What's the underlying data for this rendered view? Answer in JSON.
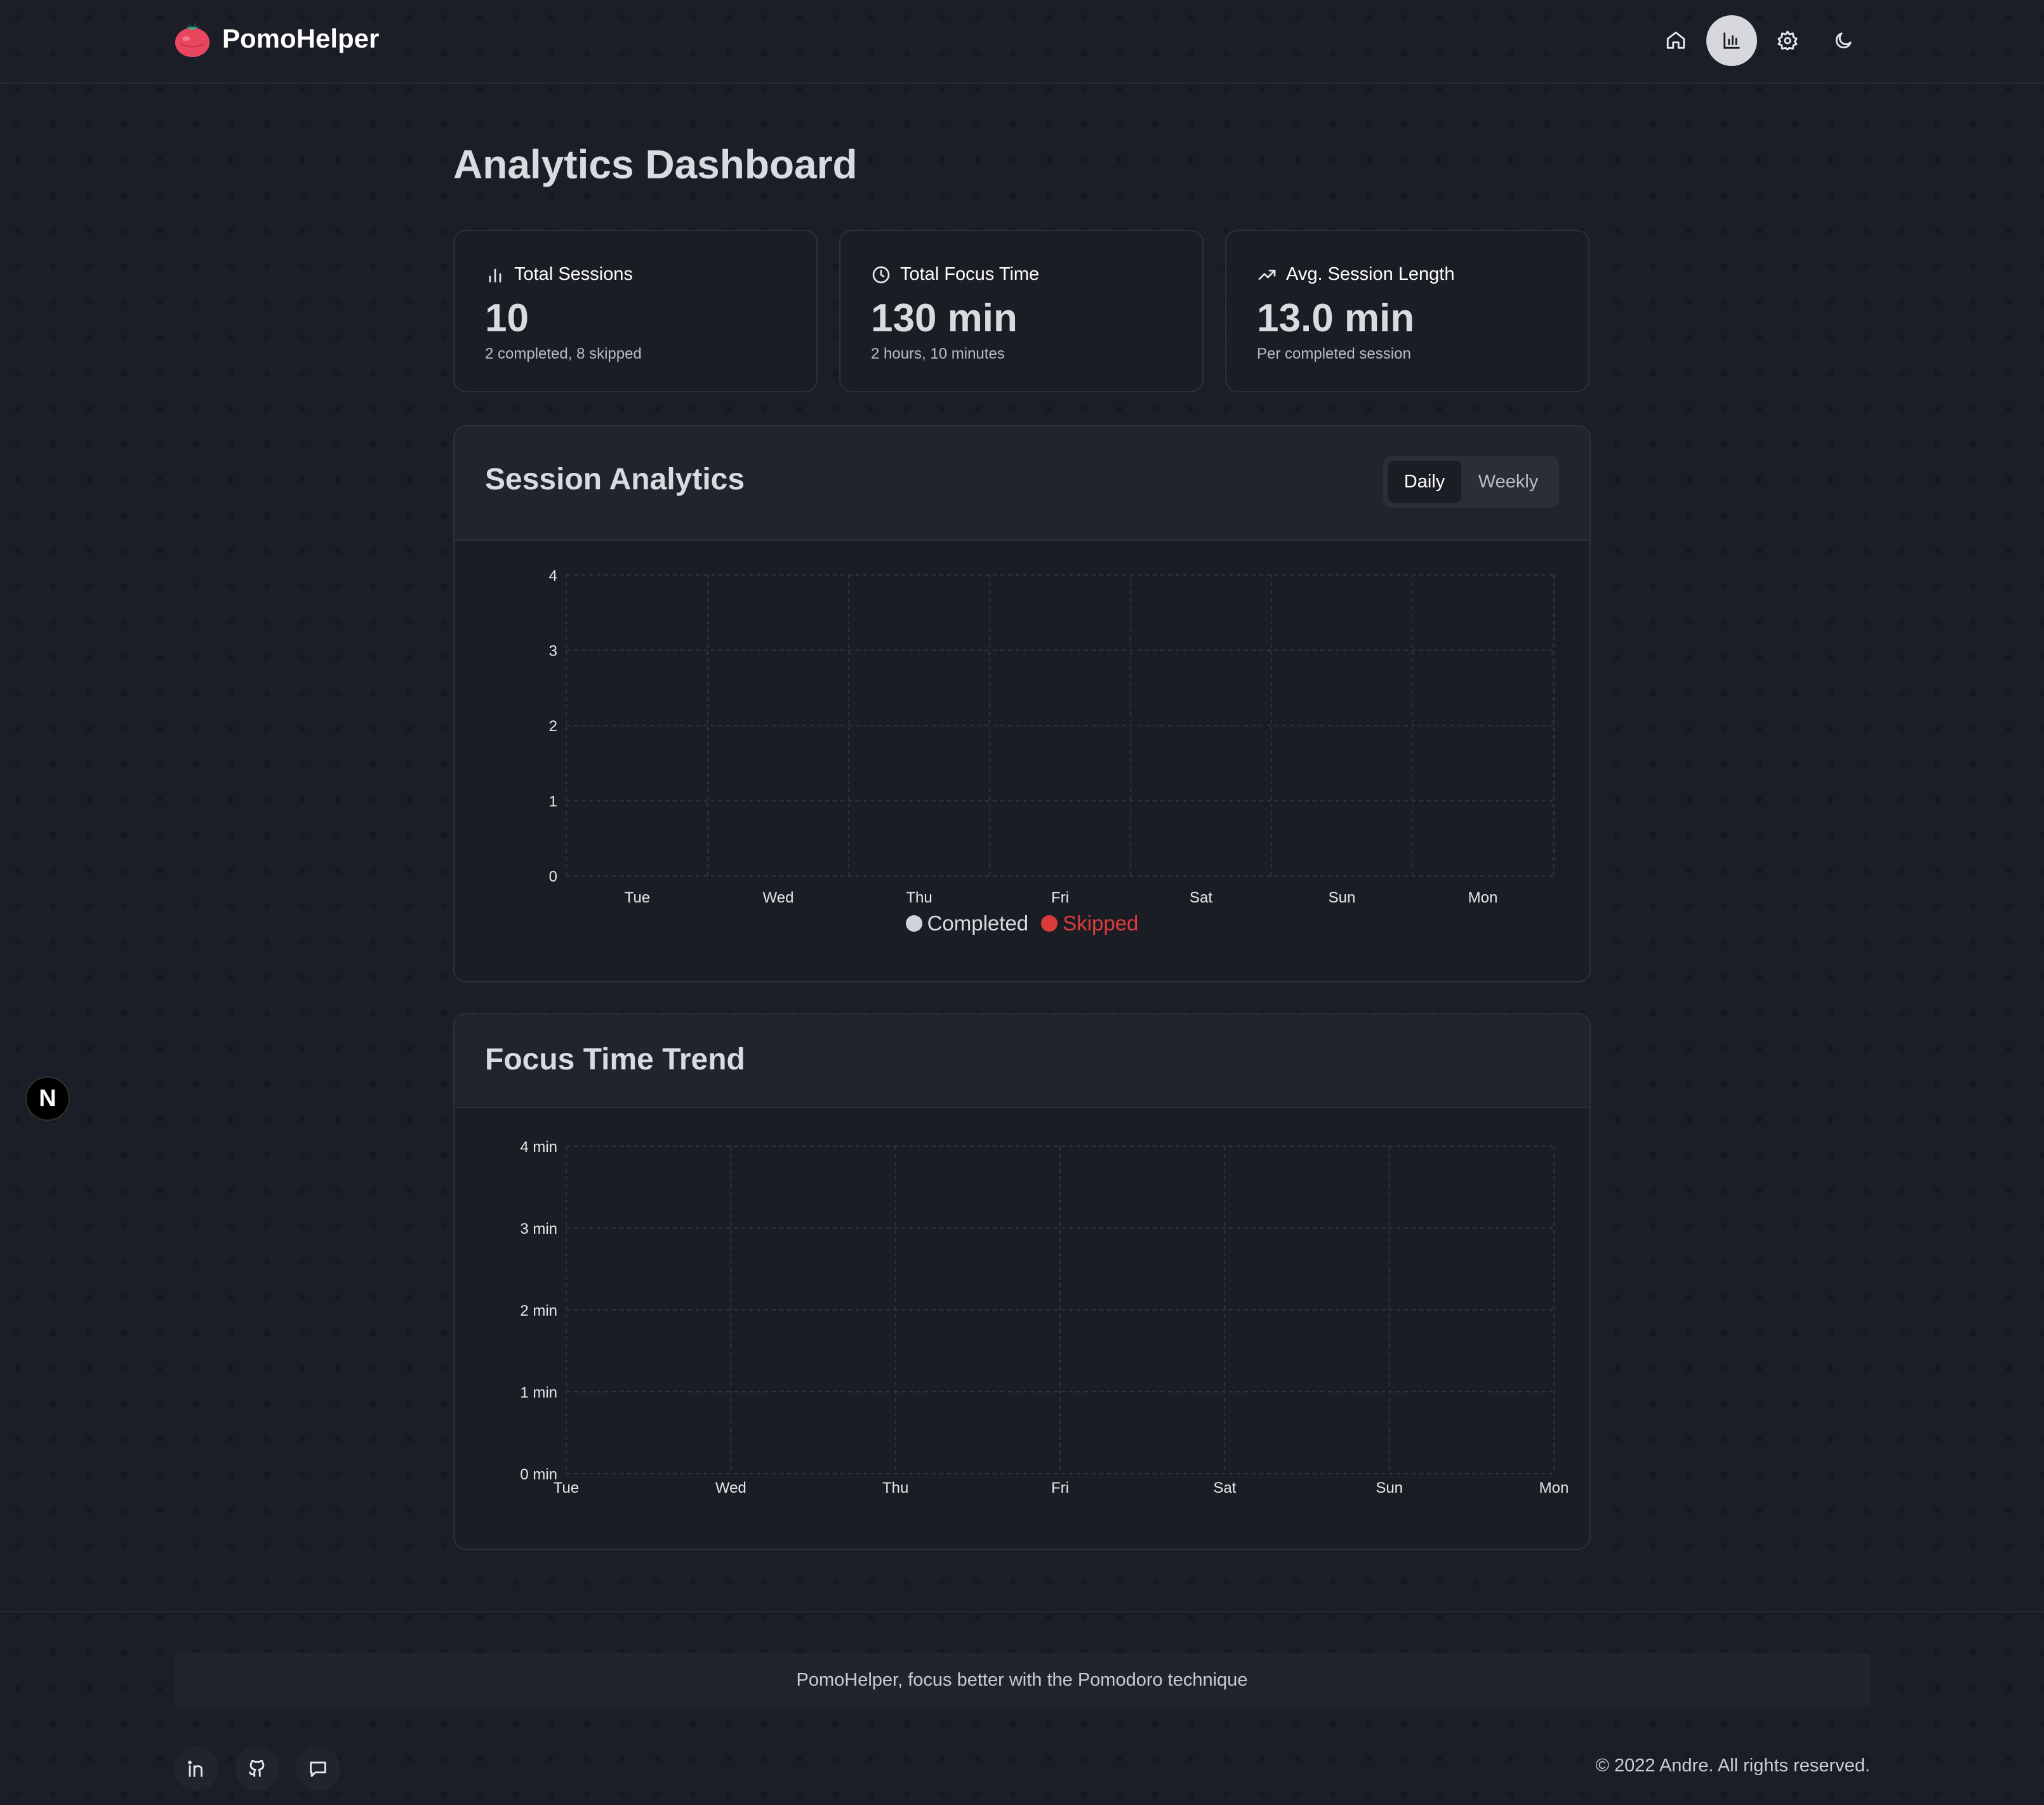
{
  "app": {
    "name": "PomoHelper"
  },
  "nav": {
    "items": [
      "home-icon",
      "analytics-icon",
      "settings-icon",
      "dark-mode-icon"
    ],
    "active": "analytics-icon"
  },
  "page": {
    "title": "Analytics Dashboard"
  },
  "stats": [
    {
      "label": "Total Sessions",
      "value": "10",
      "sub": "2 completed, 8 skipped",
      "icon": "bar-chart-icon"
    },
    {
      "label": "Total Focus Time",
      "value": "130 min",
      "sub": "2 hours, 10 minutes",
      "icon": "clock-icon"
    },
    {
      "label": "Avg. Session Length",
      "value": "13.0 min",
      "sub": "Per completed session",
      "icon": "trending-up-icon"
    }
  ],
  "session_panel": {
    "title": "Session Analytics",
    "toggle": {
      "daily": "Daily",
      "weekly": "Weekly",
      "selected": "Daily"
    },
    "legend": {
      "completed": "Completed",
      "skipped": "Skipped"
    }
  },
  "trend_panel": {
    "title": "Focus Time Trend"
  },
  "footer": {
    "tagline": "PomoHelper, focus better with the Pomodoro technique",
    "copyright": "© 2022 Andre. All rights reserved.",
    "social": [
      "linkedin-icon",
      "github-icon",
      "chat-icon"
    ]
  },
  "badge": {
    "text": "N"
  },
  "colors": {
    "completed": "#d1d5db",
    "skipped": "#dc3b3b",
    "accent": "#e8475f"
  },
  "chart_data": [
    {
      "type": "bar",
      "title": "Session Analytics",
      "categories": [
        "Tue",
        "Wed",
        "Thu",
        "Fri",
        "Sat",
        "Sun",
        "Mon"
      ],
      "series": [
        {
          "name": "Completed",
          "values": [
            0,
            0,
            0,
            0,
            0,
            0,
            0
          ]
        },
        {
          "name": "Skipped",
          "values": [
            0,
            0,
            0,
            0,
            0,
            0,
            0
          ]
        }
      ],
      "yticks": [
        "0",
        "1",
        "2",
        "3",
        "4"
      ],
      "ylim": [
        0,
        4
      ],
      "grid": true,
      "legend": "bottom"
    },
    {
      "type": "line",
      "title": "Focus Time Trend",
      "categories": [
        "Tue",
        "Wed",
        "Thu",
        "Fri",
        "Sat",
        "Sun",
        "Mon"
      ],
      "series": [
        {
          "values": [
            0,
            0,
            0,
            0,
            0,
            0,
            0
          ]
        }
      ],
      "yticks": [
        "0 min",
        "1 min",
        "2 min",
        "3 min",
        "4 min"
      ],
      "ylim": [
        0,
        4
      ],
      "grid": true
    }
  ]
}
